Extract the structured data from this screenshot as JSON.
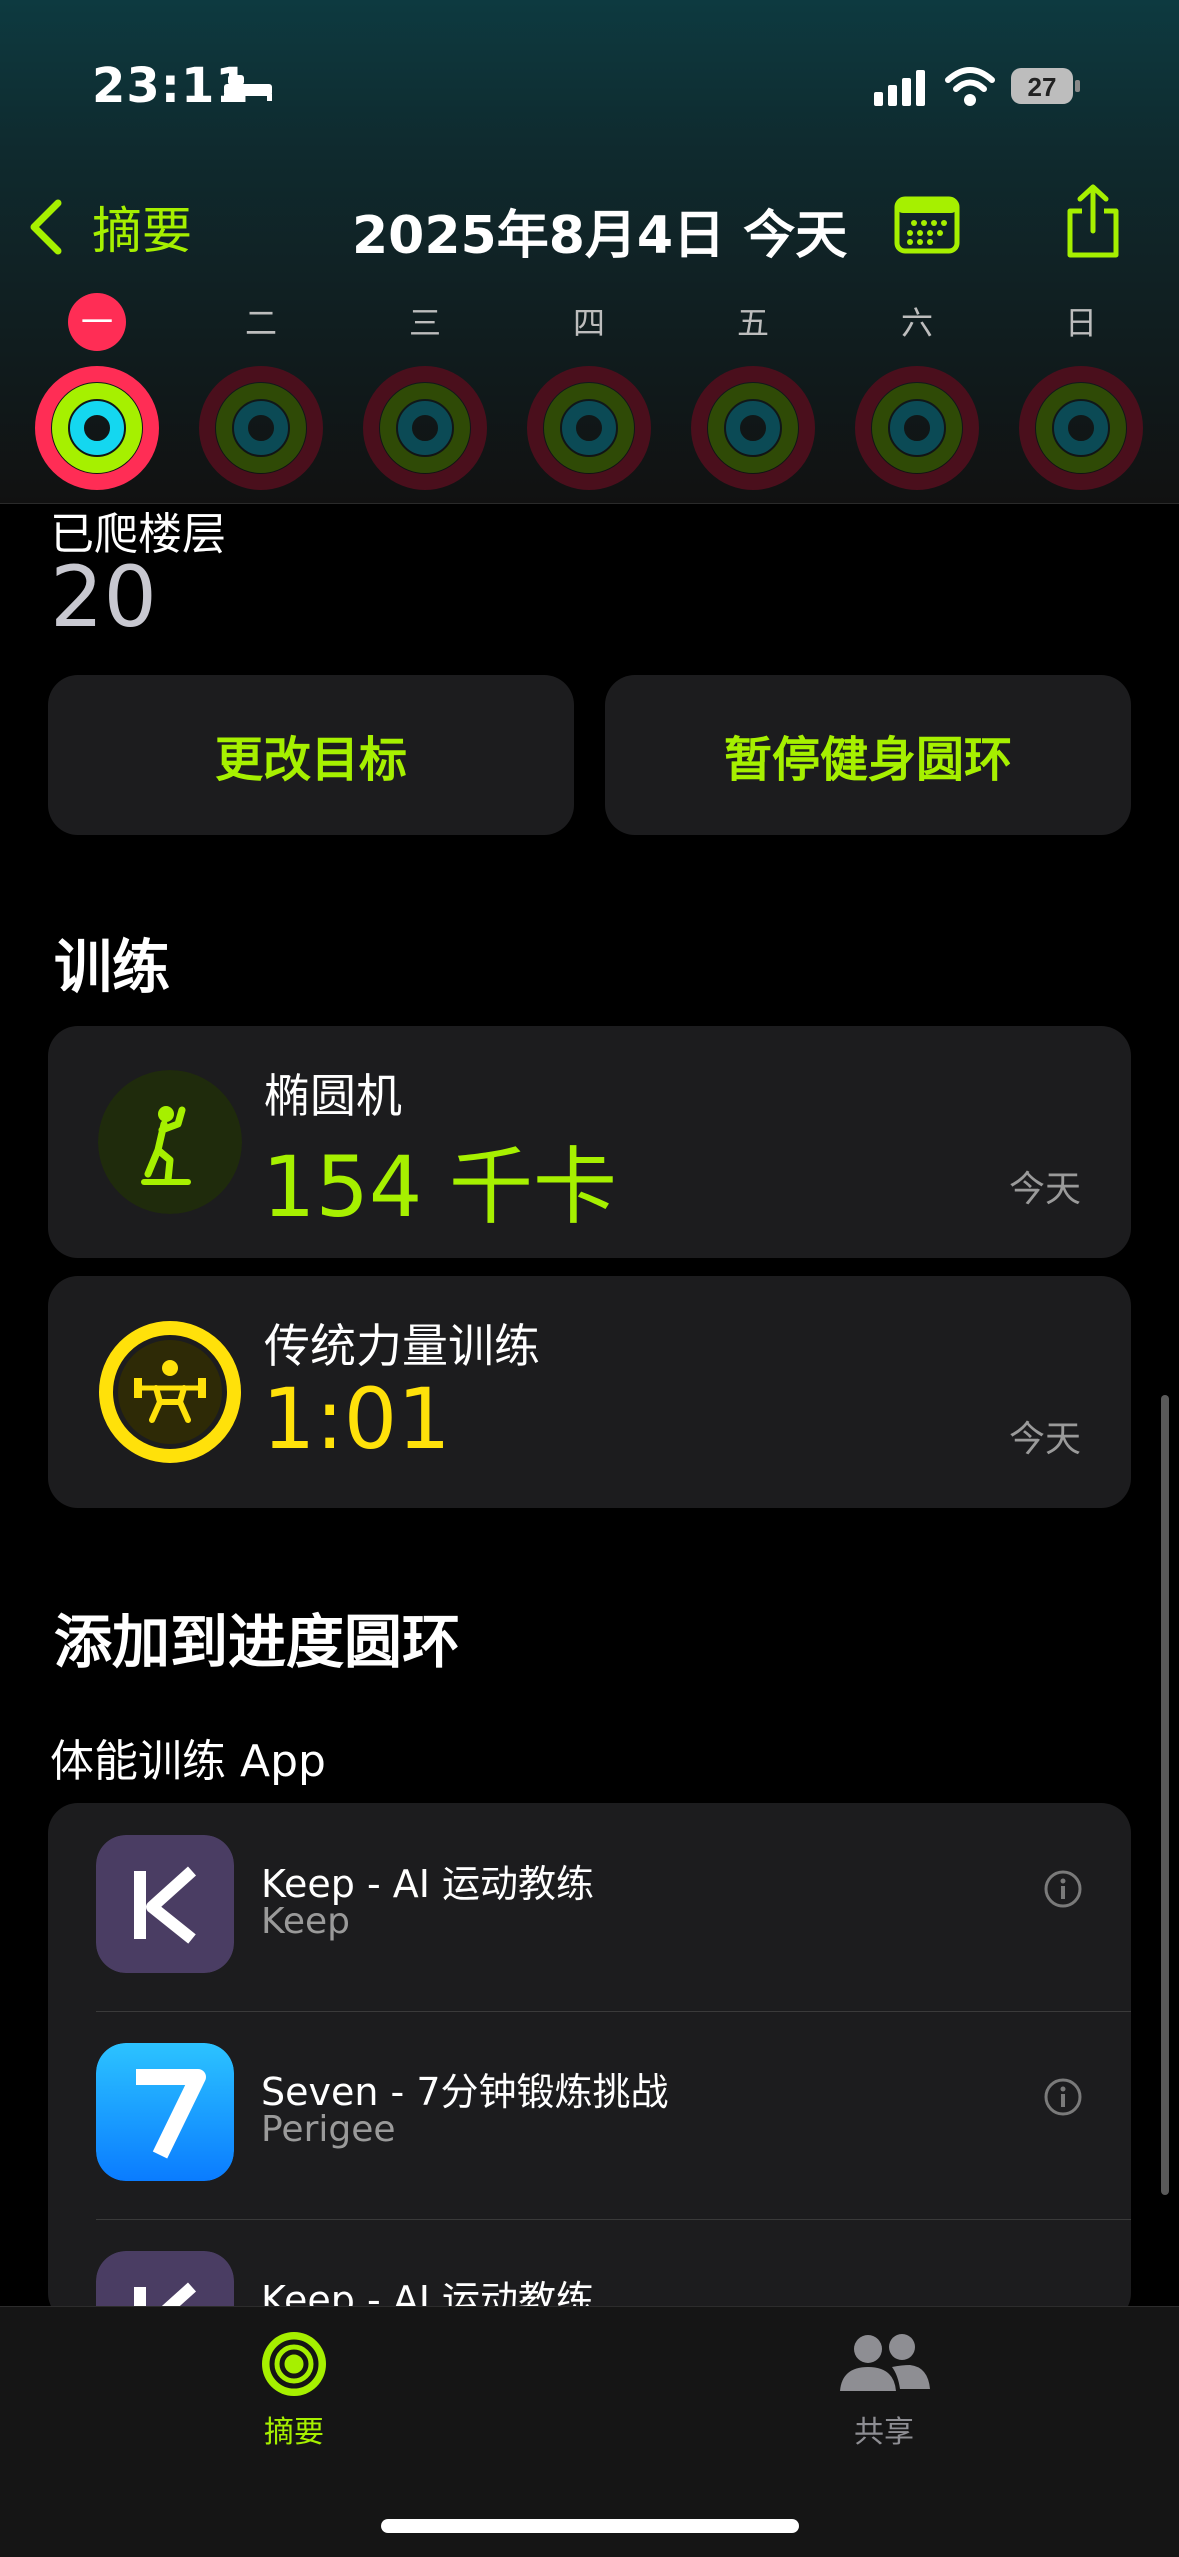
{
  "status_bar": {
    "time": "23:11",
    "battery": "27"
  },
  "nav": {
    "back_label": "摘要",
    "title": "2025年8月4日 今天"
  },
  "week": {
    "days": [
      "一",
      "二",
      "三",
      "四",
      "五",
      "六",
      "日"
    ],
    "today_index": 0
  },
  "floors": {
    "label": "已爬楼层",
    "value": "20"
  },
  "actions": {
    "change_goal": "更改目标",
    "pause_rings": "暂停健身圆环"
  },
  "workouts": {
    "title": "训练",
    "items": [
      {
        "name": "椭圆机",
        "value": "154 千卡",
        "when": "今天",
        "color": "#a6f000"
      },
      {
        "name": "传统力量训练",
        "value": "1:01",
        "when": "今天",
        "color": "#ffe10a"
      }
    ]
  },
  "add_to_rings": {
    "title": "添加到进度圆环",
    "subtitle": "体能训练 App",
    "apps": [
      {
        "name": "Keep - AI 运动教练",
        "developer": "Keep",
        "icon": "keep-icon"
      },
      {
        "name": "Seven - 7分钟锻炼挑战",
        "developer": "Perigee",
        "icon": "seven-icon"
      },
      {
        "name": "Keep - AI 运动教练",
        "developer": "",
        "icon": "keep-icon"
      }
    ]
  },
  "tabbar": {
    "summary": "摘要",
    "sharing": "共享"
  },
  "colors": {
    "accent": "#a6f000",
    "move": "#ff2d55",
    "exercise": "#a6f000",
    "stand": "#14d7f0",
    "strength": "#ffe10a"
  }
}
